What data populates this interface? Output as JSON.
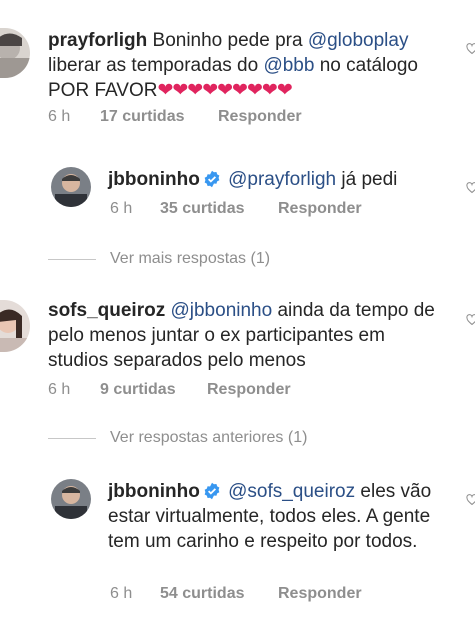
{
  "comments": [
    {
      "username": "prayforligh",
      "text_parts": [
        "Boninho pede pra ",
        "@globoplay",
        " liberar as temporadas do ",
        "@bbb",
        " no catálogo POR FAVOR"
      ],
      "hearts": "❤❤❤❤❤❤❤❤❤",
      "time": "6 h",
      "likes": "17 curtidas",
      "reply": "Responder"
    },
    {
      "username": "jbboninho",
      "verified": true,
      "text_parts": [
        "@prayforligh",
        " já pedi"
      ],
      "time": "6 h",
      "likes": "35 curtidas",
      "reply": "Responder"
    },
    {
      "username": "sofs_queiroz",
      "text_parts": [
        "@jbboninho",
        " ainda da tempo de pelo menos juntar o ex participantes em studios separados pelo menos"
      ],
      "time": "6 h",
      "likes": "9 curtidas",
      "reply": "Responder"
    },
    {
      "username": "jbboninho",
      "verified": true,
      "text_parts": [
        "@sofs_queiroz",
        " eles vão estar virtualmente, todos eles. A gente tem um carinho e respeito por todos."
      ],
      "time": "6 h",
      "likes": "54 curtidas",
      "reply": "Responder"
    }
  ],
  "view_more_replies": "Ver mais respostas (1)",
  "view_previous_replies": "Ver respostas anteriores (1)",
  "colors": {
    "mention": "#2b4f86",
    "heart": "#e0245e",
    "meta": "#8e8e8e",
    "verified": "#3897f0"
  }
}
